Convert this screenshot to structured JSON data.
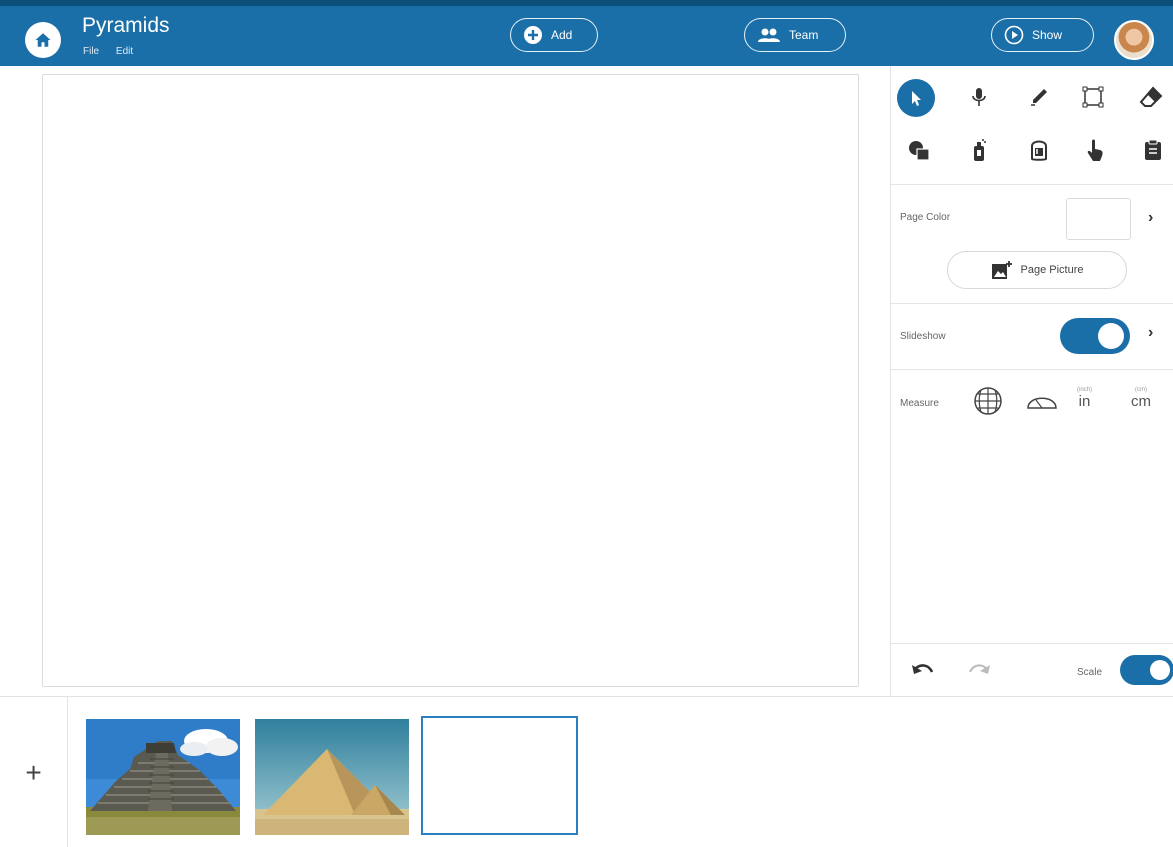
{
  "header": {
    "title": "Pyramids",
    "menu": [
      "File",
      "Edit"
    ],
    "add_label": "Add",
    "team_label": "Team",
    "show_label": "Show"
  },
  "tools": {
    "row1": [
      "select-icon",
      "microphone-icon",
      "pen-icon",
      "shape-icon",
      "eraser-icon"
    ],
    "row2": [
      "layers-icon",
      "spray-icon",
      "fill-icon",
      "pointer-hand-icon",
      "clipboard-icon"
    ]
  },
  "panel": {
    "page_color_label": "Page Color",
    "page_picture_label": "Page Picture",
    "slideshow_label": "Slideshow",
    "slideshow_on": true,
    "measure_label": "Measure",
    "unit_in_small": "(inch)",
    "unit_in": "in",
    "unit_cm_small": "(cm)",
    "unit_cm": "cm",
    "scale_label": "Scale",
    "scale_on": true
  },
  "pages": {
    "add_label": "+",
    "thumbnails": [
      {
        "name": "page-thumbnail-mayan-pyramid"
      },
      {
        "name": "page-thumbnail-egyptian-pyramids"
      },
      {
        "name": "page-thumbnail-blank",
        "selected": true
      }
    ]
  },
  "colors": {
    "brand": "#1a6fa8",
    "brand_dark": "#0c4f7a"
  }
}
